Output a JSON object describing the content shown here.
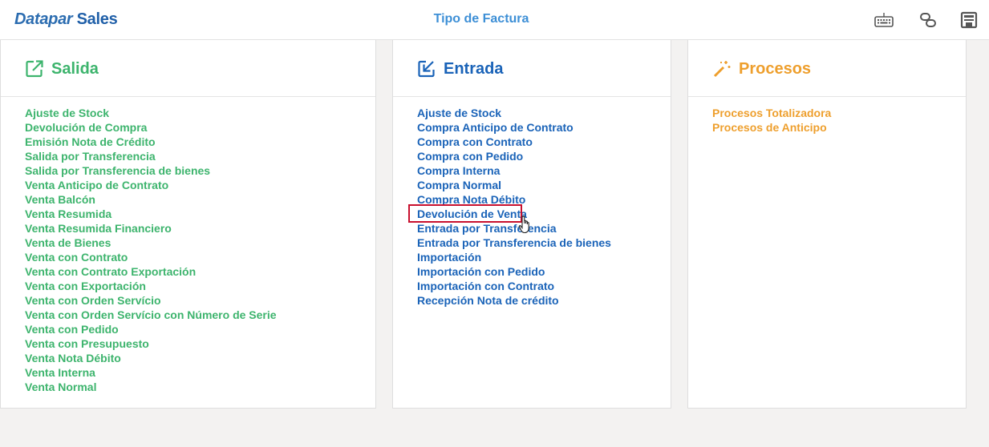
{
  "header": {
    "brand_part1": "Datapar",
    "brand_part2": "Sales",
    "title": "Tipo de Factura",
    "icons": [
      "keyboard-icon",
      "switch-icon",
      "save-icon"
    ]
  },
  "colors": {
    "salida": "#3db46d",
    "entrada": "#1a63b8",
    "procesos": "#ee9f2d",
    "highlight": "#c8102e"
  },
  "salida": {
    "title": "Salida",
    "items": [
      "Ajuste de Stock",
      "Devolución de Compra",
      "Emisión Nota de Crédito",
      "Salida por Transferencia",
      "Salida por Transferencia de bienes",
      "Venta Anticipo de Contrato",
      "Venta Balcón",
      "Venta Resumida",
      "Venta Resumida Financiero",
      "Venta de Bienes",
      "Venta con Contrato",
      "Venta con Contrato Exportación",
      "Venta con Exportación",
      "Venta con Orden Servício",
      "Venta con Orden Servício con Número de Serie",
      "Venta con Pedido",
      "Venta con Presupuesto",
      "Venta Nota Débito",
      "Venta Interna",
      "Venta Normal"
    ]
  },
  "entrada": {
    "title": "Entrada",
    "items": [
      "Ajuste de Stock",
      "Compra Anticipo de Contrato",
      "Compra con Contrato",
      "Compra con Pedido",
      "Compra Interna",
      "Compra Normal",
      "Compra Nota Débito",
      "Devolución de Venta",
      "Entrada por Transferencia",
      "Entrada por Transferencia de bienes",
      "Importación",
      "Importación con Pedido",
      "Importación con Contrato",
      "Recepción Nota de crédito"
    ]
  },
  "procesos": {
    "title": "Procesos",
    "items": [
      "Procesos Totalizadora",
      "Procesos de Anticipo"
    ]
  }
}
